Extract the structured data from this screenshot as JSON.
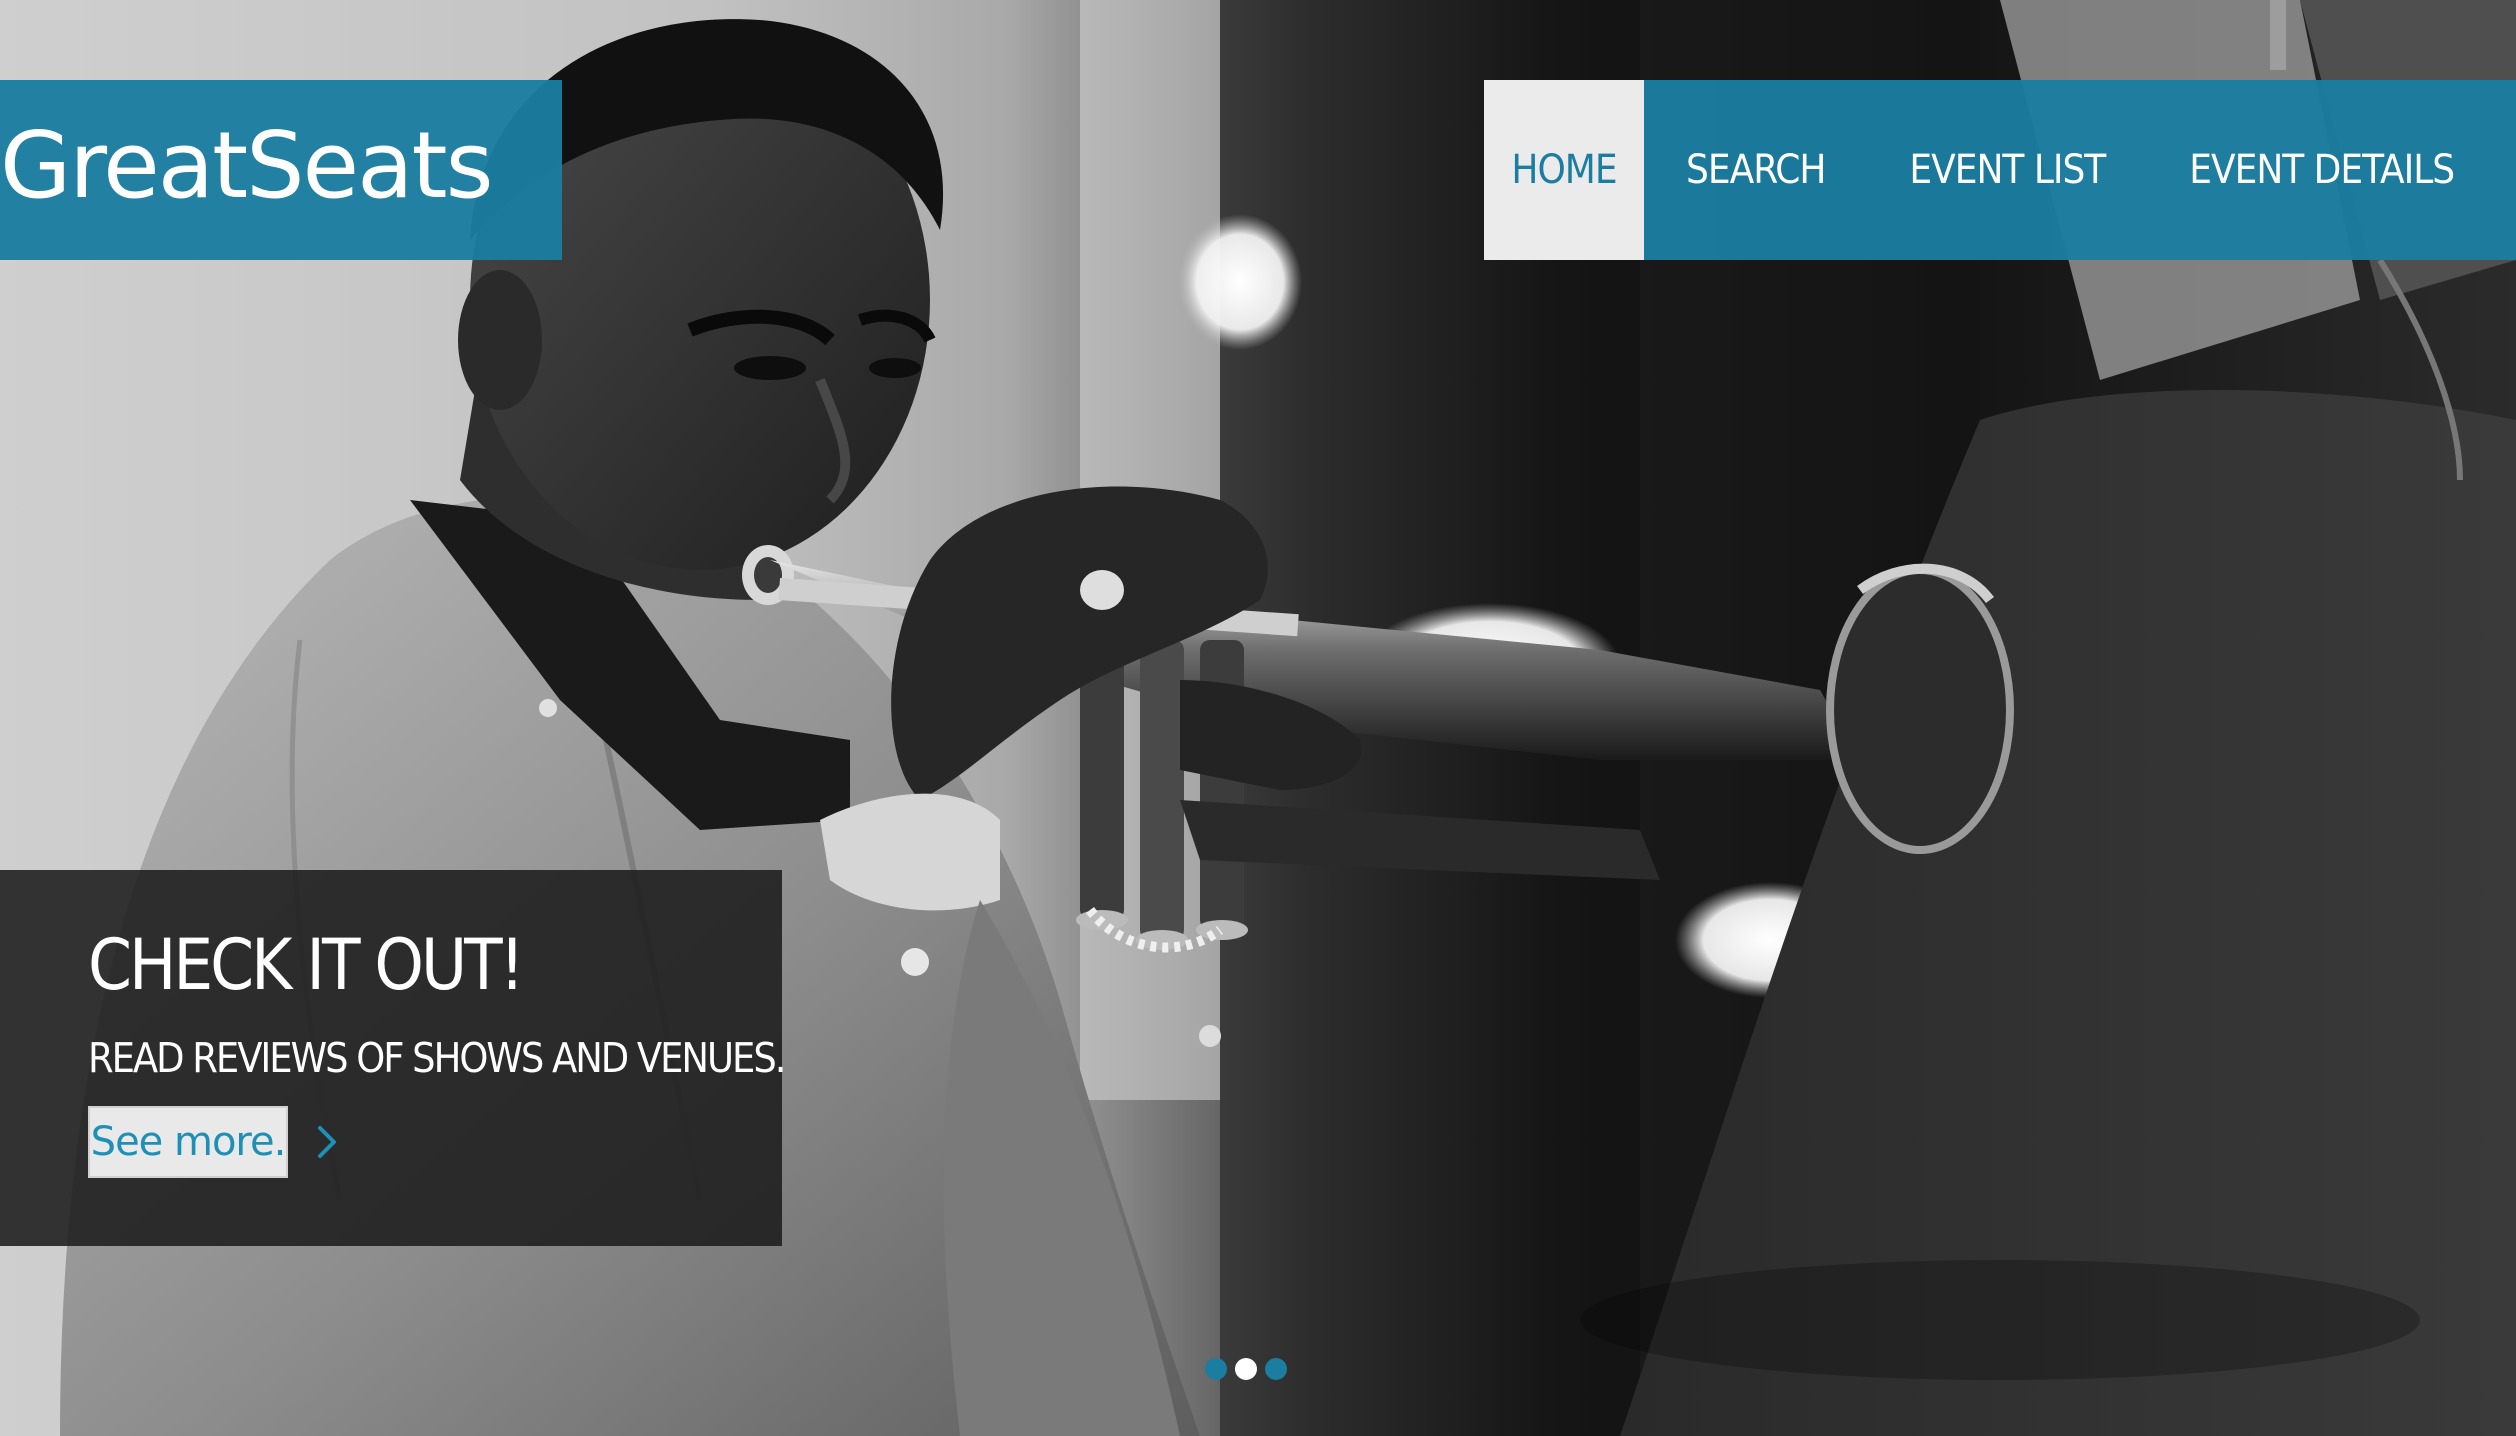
{
  "brand": {
    "name": "GreatSeats"
  },
  "nav": {
    "items": [
      {
        "label": "HOME",
        "active": true
      },
      {
        "label": "SEARCH",
        "active": false
      },
      {
        "label": "EVENT LIST",
        "active": false
      },
      {
        "label": "EVENT DETAILS",
        "active": false
      }
    ]
  },
  "hero": {
    "headline": "CHECK IT OUT!",
    "subheadline": "READ REVIEWS OF SHOWS AND VENUES.",
    "cta_label": "See more.",
    "cta_icon": "chevron-right-icon",
    "image_icon": "hero-photo-trumpet-player"
  },
  "carousel": {
    "slide_count": 3,
    "active_index": 1
  },
  "colors": {
    "brand_blue": "#1b7da0",
    "link_blue": "#1e8fb5",
    "active_nav_bg": "#ebebeb",
    "caption_bg": "#1c1c1c"
  }
}
